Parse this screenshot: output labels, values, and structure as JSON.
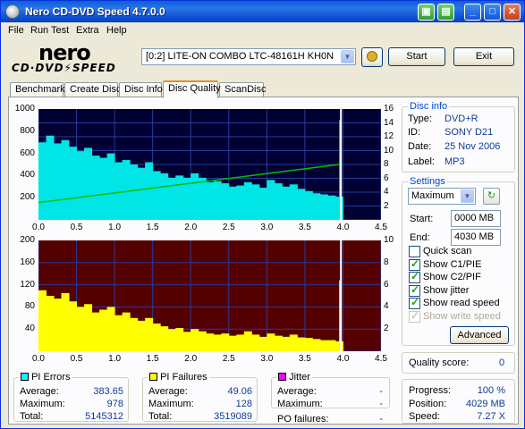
{
  "window": {
    "title": "Nero CD-DVD Speed 4.7.0.0",
    "buttons": {
      "tray": "▣",
      "save": "▤",
      "minimize": "_",
      "maximize": "□",
      "close": "✕"
    }
  },
  "menu": [
    "File",
    "Run Test",
    "Extra",
    "Help"
  ],
  "logo": {
    "brand": "nero",
    "product": "CD·DVD⚡SPEED"
  },
  "drive": {
    "value": "[0:2]   LITE-ON COMBO LTC-48161H KH0N"
  },
  "toolbar": {
    "start": "Start",
    "exit": "Exit"
  },
  "tabs": [
    {
      "label": "Benchmark"
    },
    {
      "label": "Create Disc"
    },
    {
      "label": "Disc Info"
    },
    {
      "label": "Disc Quality",
      "active": true
    },
    {
      "label": "ScanDisc"
    }
  ],
  "chart_data": [
    {
      "type": "area",
      "name": "PI Errors",
      "background": "#000033",
      "fill_color": "#00e5e5",
      "x": {
        "range": [
          0,
          4.5
        ],
        "ticks": [
          "0.0",
          "0.5",
          "1.0",
          "1.5",
          "2.0",
          "2.5",
          "3.0",
          "3.5",
          "4.0",
          "4.5"
        ]
      },
      "y_left": {
        "range": [
          0,
          1000
        ],
        "ticks": [
          "1000",
          "800",
          "600",
          "400",
          "200"
        ]
      },
      "y_right": {
        "range": [
          0,
          16
        ],
        "ticks": [
          "16",
          "14",
          "12",
          "10",
          "8",
          "6",
          "4",
          "2"
        ]
      },
      "series": [
        {
          "x": [
            0.0,
            0.1,
            0.2,
            0.3,
            0.4,
            0.5,
            0.6,
            0.7,
            0.8,
            0.9,
            1.0,
            1.1,
            1.2,
            1.3,
            1.4,
            1.5,
            1.6,
            1.7,
            1.8,
            1.9,
            2.0,
            2.1,
            2.2,
            2.3,
            2.4,
            2.5,
            2.6,
            2.7,
            2.8,
            2.9,
            3.0,
            3.1,
            3.2,
            3.3,
            3.4,
            3.5,
            3.6,
            3.7,
            3.8,
            3.9,
            3.95
          ],
          "values": [
            700,
            760,
            690,
            720,
            660,
            620,
            650,
            580,
            560,
            600,
            520,
            540,
            500,
            470,
            520,
            440,
            420,
            380,
            400,
            380,
            420,
            380,
            340,
            350,
            330,
            300,
            310,
            340,
            320,
            290,
            360,
            330,
            300,
            320,
            280,
            260,
            240,
            230,
            220,
            210,
            900
          ]
        },
        {
          "name": "read speed",
          "color": "#00c000",
          "x": [
            0.0,
            3.95
          ],
          "values": [
            2.5,
            8.0
          ]
        }
      ]
    },
    {
      "type": "area",
      "name": "PI Failures",
      "background": "#550000",
      "fill_color": "#ffff00",
      "x": {
        "range": [
          0,
          4.5
        ],
        "ticks": [
          "0.0",
          "0.5",
          "1.0",
          "1.5",
          "2.0",
          "2.5",
          "3.0",
          "3.5",
          "4.0",
          "4.5"
        ]
      },
      "y_left": {
        "range": [
          0,
          200
        ],
        "ticks": [
          "200",
          "160",
          "120",
          "80",
          "40"
        ]
      },
      "y_right": {
        "range": [
          0,
          10
        ],
        "ticks": [
          "10",
          "8",
          "6",
          "4",
          "2"
        ]
      },
      "series": [
        {
          "x": [
            0.0,
            0.1,
            0.2,
            0.3,
            0.4,
            0.5,
            0.6,
            0.7,
            0.8,
            0.9,
            1.0,
            1.1,
            1.2,
            1.3,
            1.4,
            1.5,
            1.6,
            1.7,
            1.8,
            1.9,
            2.0,
            2.1,
            2.2,
            2.3,
            2.4,
            2.5,
            2.6,
            2.7,
            2.8,
            2.9,
            3.0,
            3.1,
            3.2,
            3.3,
            3.4,
            3.5,
            3.6,
            3.7,
            3.8,
            3.9,
            3.95
          ],
          "values": [
            110,
            100,
            95,
            105,
            90,
            80,
            85,
            70,
            75,
            80,
            65,
            70,
            60,
            55,
            60,
            50,
            45,
            40,
            42,
            35,
            40,
            36,
            32,
            30,
            32,
            28,
            30,
            36,
            30,
            26,
            32,
            28,
            26,
            30,
            25,
            24,
            22,
            20,
            20,
            18,
            128
          ]
        }
      ]
    }
  ],
  "disc_info": {
    "title": "Disc info",
    "rows": [
      {
        "key": "Type:",
        "value": "DVD+R"
      },
      {
        "key": "ID:",
        "value": "SONY D21"
      },
      {
        "key": "Date:",
        "value": "25 Nov 2006"
      },
      {
        "key": "Label:",
        "value": "MP3"
      }
    ]
  },
  "settings": {
    "title": "Settings",
    "speed": "Maximum",
    "start_label": "Start:",
    "start_value": "0000 MB",
    "end_label": "End:",
    "end_value": "4030 MB",
    "checks": [
      {
        "label": "Quick scan",
        "checked": false,
        "disabled": false
      },
      {
        "label": "Show C1/PIE",
        "checked": true,
        "disabled": false
      },
      {
        "label": "Show C2/PIF",
        "checked": true,
        "disabled": false
      },
      {
        "label": "Show jitter",
        "checked": true,
        "disabled": false
      },
      {
        "label": "Show read speed",
        "checked": true,
        "disabled": false
      },
      {
        "label": "Show write speed",
        "checked": true,
        "disabled": true
      }
    ],
    "advanced": "Advanced"
  },
  "quality": {
    "label": "Quality score:",
    "value": "0"
  },
  "progress": {
    "rows": [
      {
        "key": "Progress:",
        "value": "100 %"
      },
      {
        "key": "Position:",
        "value": "4029 MB"
      },
      {
        "key": "Speed:",
        "value": "7.27 X"
      }
    ]
  },
  "stats": {
    "pi_errors": {
      "title": "PI Errors",
      "color": "#00ffff",
      "rows": [
        {
          "key": "Average:",
          "value": "383.65"
        },
        {
          "key": "Maximum:",
          "value": "978"
        },
        {
          "key": "Total:",
          "value": "5145312"
        }
      ]
    },
    "pi_failures": {
      "title": "PI Failures",
      "color": "#ffff00",
      "rows": [
        {
          "key": "Average:",
          "value": "49.06"
        },
        {
          "key": "Maximum:",
          "value": "128"
        },
        {
          "key": "Total:",
          "value": "3519089"
        }
      ]
    },
    "jitter": {
      "title": "Jitter",
      "color": "#ff00ff",
      "rows": [
        {
          "key": "Average:",
          "value": "-"
        },
        {
          "key": "Maximum:",
          "value": "-"
        }
      ]
    },
    "po_failures": {
      "label": "PO failures:",
      "value": "-"
    }
  }
}
